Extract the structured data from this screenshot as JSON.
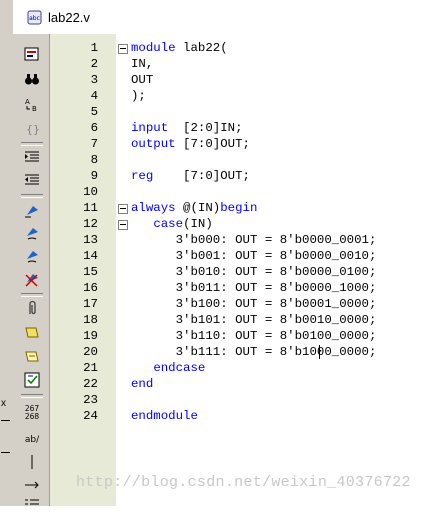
{
  "tab": {
    "title": "lab22.v",
    "icon": "verilog-file-icon"
  },
  "toolbar": {
    "line_numbers_top": "267",
    "line_numbers_bottom": "268",
    "ab_label": "ab/"
  },
  "left_strip": {
    "close_glyph": "x"
  },
  "editor": {
    "lines": [
      {
        "n": "1",
        "code": "module lab22("
      },
      {
        "n": "2",
        "code": "IN,"
      },
      {
        "n": "3",
        "code": "OUT"
      },
      {
        "n": "4",
        "code": ");"
      },
      {
        "n": "5",
        "code": ""
      },
      {
        "n": "6",
        "code": "input  [2:0]IN;"
      },
      {
        "n": "7",
        "code": "output [7:0]OUT;"
      },
      {
        "n": "8",
        "code": ""
      },
      {
        "n": "9",
        "code": "reg    [7:0]OUT;"
      },
      {
        "n": "10",
        "code": ""
      },
      {
        "n": "11",
        "code": "always @(IN)begin"
      },
      {
        "n": "12",
        "code": "   case(IN)"
      },
      {
        "n": "13",
        "code": "      3'b000: OUT = 8'b0000_0001;"
      },
      {
        "n": "14",
        "code": "      3'b001: OUT = 8'b0000_0010;"
      },
      {
        "n": "15",
        "code": "      3'b010: OUT = 8'b0000_0100;"
      },
      {
        "n": "16",
        "code": "      3'b011: OUT = 8'b0000_1000;"
      },
      {
        "n": "17",
        "code": "      3'b100: OUT = 8'b0001_0000;"
      },
      {
        "n": "18",
        "code": "      3'b101: OUT = 8'b0010_0000;"
      },
      {
        "n": "19",
        "code": "      3'b110: OUT = 8'b0100_0000;"
      },
      {
        "n": "20",
        "code": "      3'b111: OUT = 8'b1000_0000;"
      },
      {
        "n": "21",
        "code": "   endcase"
      },
      {
        "n": "22",
        "code": "end"
      },
      {
        "n": "23",
        "code": ""
      },
      {
        "n": "24",
        "code": "endmodule"
      }
    ]
  },
  "watermark": "http://blog.csdn.net/weixin_40376722",
  "colors": {
    "keyword": "#0000ff",
    "gutter": "#e8ead8",
    "toolbar": "#d4d0c8"
  }
}
